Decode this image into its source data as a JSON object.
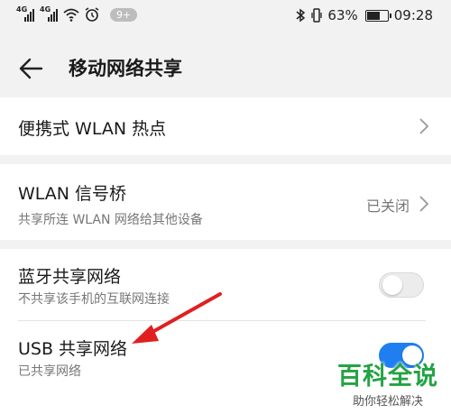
{
  "status_bar": {
    "sim1_tag": "4G",
    "sim2_tag": "4G",
    "notification_badge": "9+",
    "battery_percent": "63%",
    "time": "09:28"
  },
  "header": {
    "title": "移动网络共享"
  },
  "rows": {
    "portable_hotspot": {
      "title": "便携式 WLAN 热点"
    },
    "wlan_bridge": {
      "title": "WLAN 信号桥",
      "subtitle": "共享所连 WLAN 网络给其他设备",
      "value": "已关闭"
    },
    "bluetooth_tethering": {
      "title": "蓝牙共享网络",
      "subtitle": "不共享该手机的互联网连接",
      "enabled": false
    },
    "usb_tethering": {
      "title": "USB 共享网络",
      "subtitle": "已共享网络",
      "enabled": true
    }
  },
  "colors": {
    "toggle_on": "#1f7ff0",
    "annotation_arrow": "#e02020",
    "watermark": "#23a343"
  },
  "watermark": {
    "main": "百科全说",
    "sub": "助你轻松解决"
  }
}
